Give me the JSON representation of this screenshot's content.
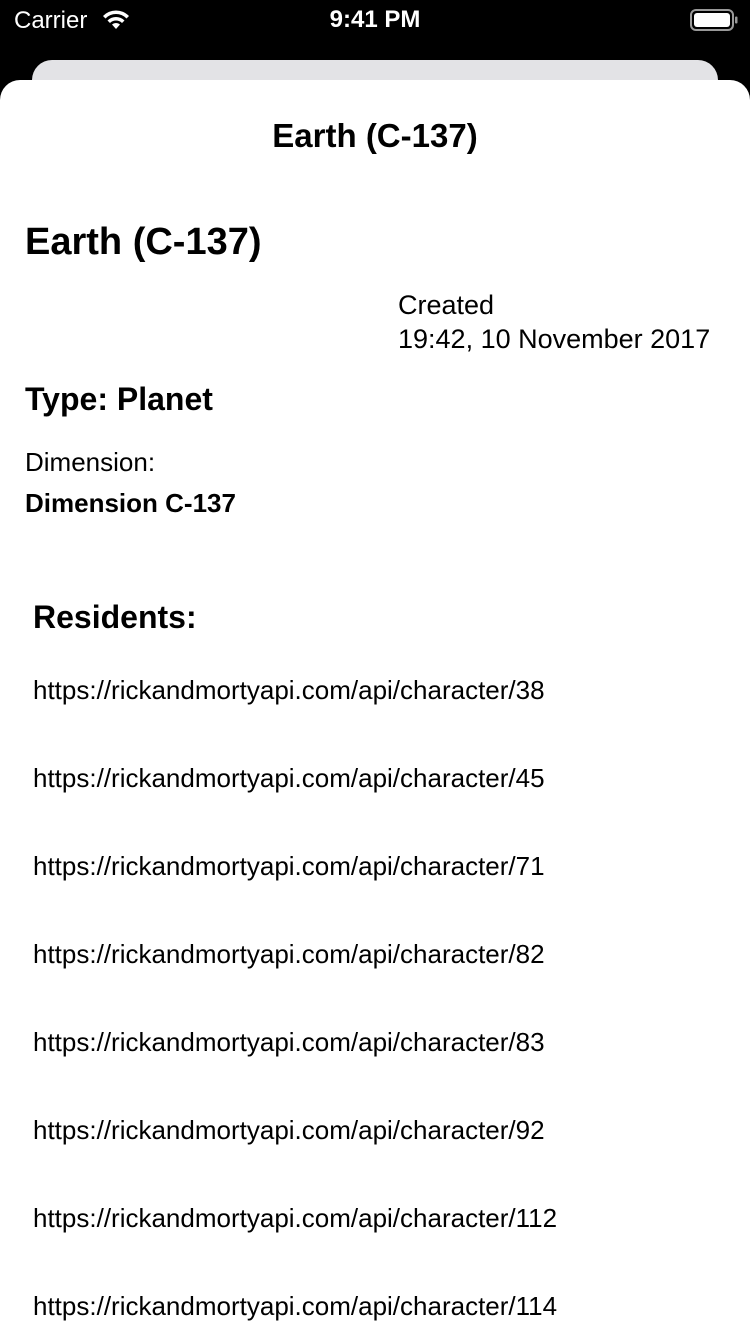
{
  "status_bar": {
    "carrier": "Carrier",
    "time": "9:41 PM",
    "wifi_icon": "wifi-icon",
    "battery_icon": "battery-icon"
  },
  "nav": {
    "title": "Earth (C-137)"
  },
  "location": {
    "name": "Earth (C-137)",
    "created_label": "Created",
    "created_value": "19:42, 10 November 2017",
    "type": "Type: Planet",
    "dimension_label": "Dimension:",
    "dimension_value": "Dimension C-137"
  },
  "residents": {
    "heading": "Residents:",
    "items": [
      "https://rickandmortyapi.com/api/character/38",
      "https://rickandmortyapi.com/api/character/45",
      "https://rickandmortyapi.com/api/character/71",
      "https://rickandmortyapi.com/api/character/82",
      "https://rickandmortyapi.com/api/character/83",
      "https://rickandmortyapi.com/api/character/92",
      "https://rickandmortyapi.com/api/character/112",
      "https://rickandmortyapi.com/api/character/114"
    ]
  },
  "colors": {
    "background": "#000000",
    "sheet": "#ffffff",
    "back_sheet": "#e3e3e6",
    "text": "#000000"
  }
}
